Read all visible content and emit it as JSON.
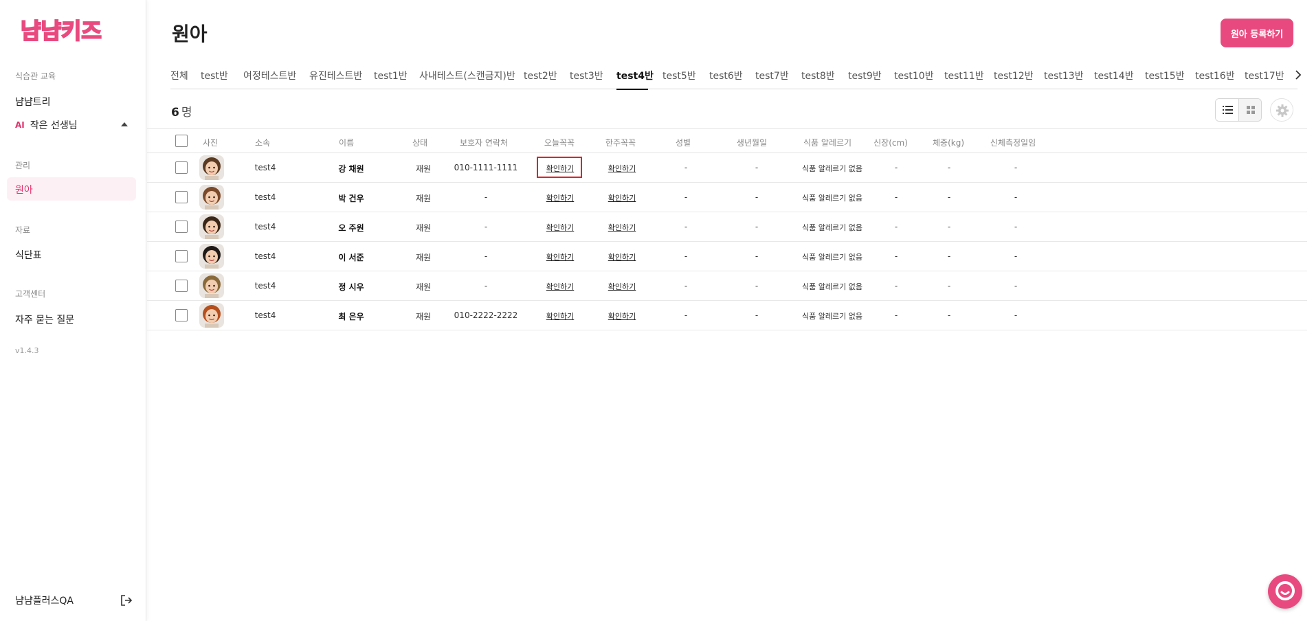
{
  "sidebar": {
    "brand": "냠냠키즈",
    "sections": [
      {
        "title": "식습관 교육",
        "items": [
          "냠냠트리"
        ]
      },
      {
        "title": "관리",
        "items": [
          "원아"
        ]
      },
      {
        "title": "자료",
        "items": [
          "식단표"
        ]
      },
      {
        "title": "고객센터",
        "items": [
          "자주 묻는 질문"
        ]
      }
    ],
    "ai_badge": "AI",
    "ai_item": "작은 선생님",
    "version": "v1.4.3",
    "user": "냠냠플러스QA"
  },
  "header": {
    "title": "원아",
    "register_label": "원아 등록하기"
  },
  "tabs": [
    "전체",
    "test반",
    "여정테스트반",
    "유진테스트반",
    "test1반",
    "사내테스트(스캔금지)반",
    "test2반",
    "test3반",
    "test4반",
    "test5반",
    "test6반",
    "test7반",
    "test8반",
    "test9반",
    "test10반",
    "test11반",
    "test12반",
    "test13반",
    "test14반",
    "test15반",
    "test16반",
    "test17반"
  ],
  "active_tab": "test4반",
  "count": {
    "number": "6",
    "unit": "명"
  },
  "table": {
    "headers": [
      "사진",
      "소속",
      "이름",
      "상태",
      "보호자 연락처",
      "오늘꼭꼭",
      "한주꼭꼭",
      "성별",
      "생년월일",
      "식품 알레르기",
      "신장(cm)",
      "체중(kg)",
      "신체측정일임"
    ],
    "rows": [
      {
        "class": "test4",
        "name": "강 채원",
        "status": "재원",
        "phone": "010-1111-1111",
        "today": "확인하기",
        "week": "확인하기",
        "gender": "-",
        "birth": "-",
        "allergy": "식품 알레르기 없음",
        "height": "-",
        "weight": "-",
        "measured": "-"
      },
      {
        "class": "test4",
        "name": "박 건우",
        "status": "재원",
        "phone": "-",
        "today": "확인하기",
        "week": "확인하기",
        "gender": "-",
        "birth": "-",
        "allergy": "식품 알레르기 없음",
        "height": "-",
        "weight": "-",
        "measured": "-"
      },
      {
        "class": "test4",
        "name": "오 주원",
        "status": "재원",
        "phone": "-",
        "today": "확인하기",
        "week": "확인하기",
        "gender": "-",
        "birth": "-",
        "allergy": "식품 알레르기 없음",
        "height": "-",
        "weight": "-",
        "measured": "-"
      },
      {
        "class": "test4",
        "name": "이 서준",
        "status": "재원",
        "phone": "-",
        "today": "확인하기",
        "week": "확인하기",
        "gender": "-",
        "birth": "-",
        "allergy": "식품 알레르기 없음",
        "height": "-",
        "weight": "-",
        "measured": "-"
      },
      {
        "class": "test4",
        "name": "정 시우",
        "status": "재원",
        "phone": "-",
        "today": "확인하기",
        "week": "확인하기",
        "gender": "-",
        "birth": "-",
        "allergy": "식품 알레르기 없음",
        "height": "-",
        "weight": "-",
        "measured": "-"
      },
      {
        "class": "test4",
        "name": "최 은우",
        "status": "재원",
        "phone": "010-2222-2222",
        "today": "확인하기",
        "week": "확인하기",
        "gender": "-",
        "birth": "-",
        "allergy": "식품 알레르기 없음",
        "height": "-",
        "weight": "-",
        "measured": "-"
      }
    ]
  },
  "colors": {
    "accent": "#e84a7f",
    "active_text": "#e0336e",
    "highlight": "#d6262a"
  }
}
